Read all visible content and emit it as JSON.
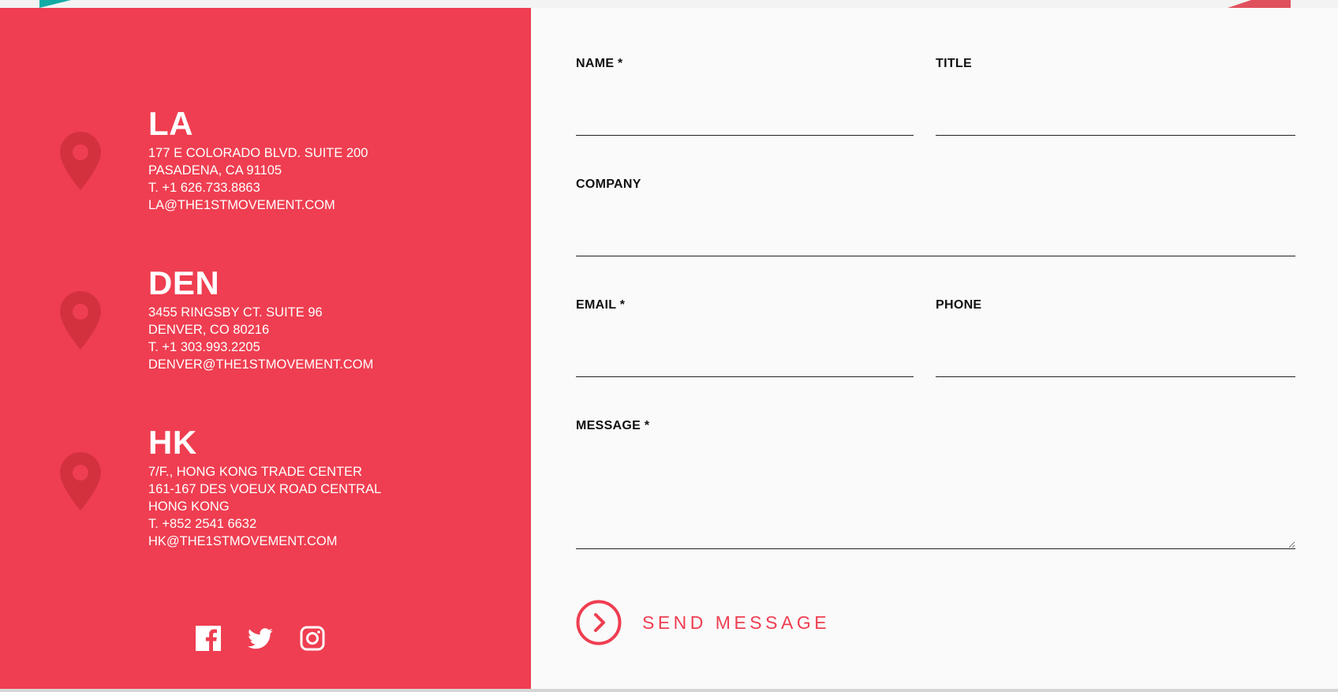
{
  "colors": {
    "accent": "#ef3e51",
    "pin": "#d4313f",
    "form_bg": "#fafafa",
    "teal_corner": "#12aba4"
  },
  "offices": [
    {
      "name": "LA",
      "lines": [
        "177 E COLORADO BLVD. SUITE 200",
        "PASADENA, CA 91105",
        "T. +1 626.733.8863",
        "LA@THE1STMOVEMENT.COM"
      ]
    },
    {
      "name": "DEN",
      "lines": [
        "3455 RINGSBY CT. SUITE 96",
        "DENVER, CO 80216",
        "T. +1 303.993.2205",
        "DENVER@THE1STMOVEMENT.COM"
      ]
    },
    {
      "name": "HK",
      "lines": [
        "7/F., HONG KONG TRADE CENTER",
        "161-167 DES VOEUX ROAD CENTRAL",
        "HONG KONG",
        "T. +852 2541 6632",
        "HK@THE1STMOVEMENT.COM"
      ]
    }
  ],
  "socials": {
    "icons": [
      "facebook-icon",
      "twitter-icon",
      "instagram-icon"
    ]
  },
  "form": {
    "name_label": "NAME *",
    "name_value": "",
    "title_label": "TITLE",
    "title_value": "",
    "company_label": "COMPANY",
    "company_value": "",
    "email_label": "EMAIL *",
    "email_value": "",
    "phone_label": "PHONE",
    "phone_value": "",
    "message_label": "MESSAGE *",
    "message_value": "",
    "send_label": "SEND MESSAGE"
  }
}
